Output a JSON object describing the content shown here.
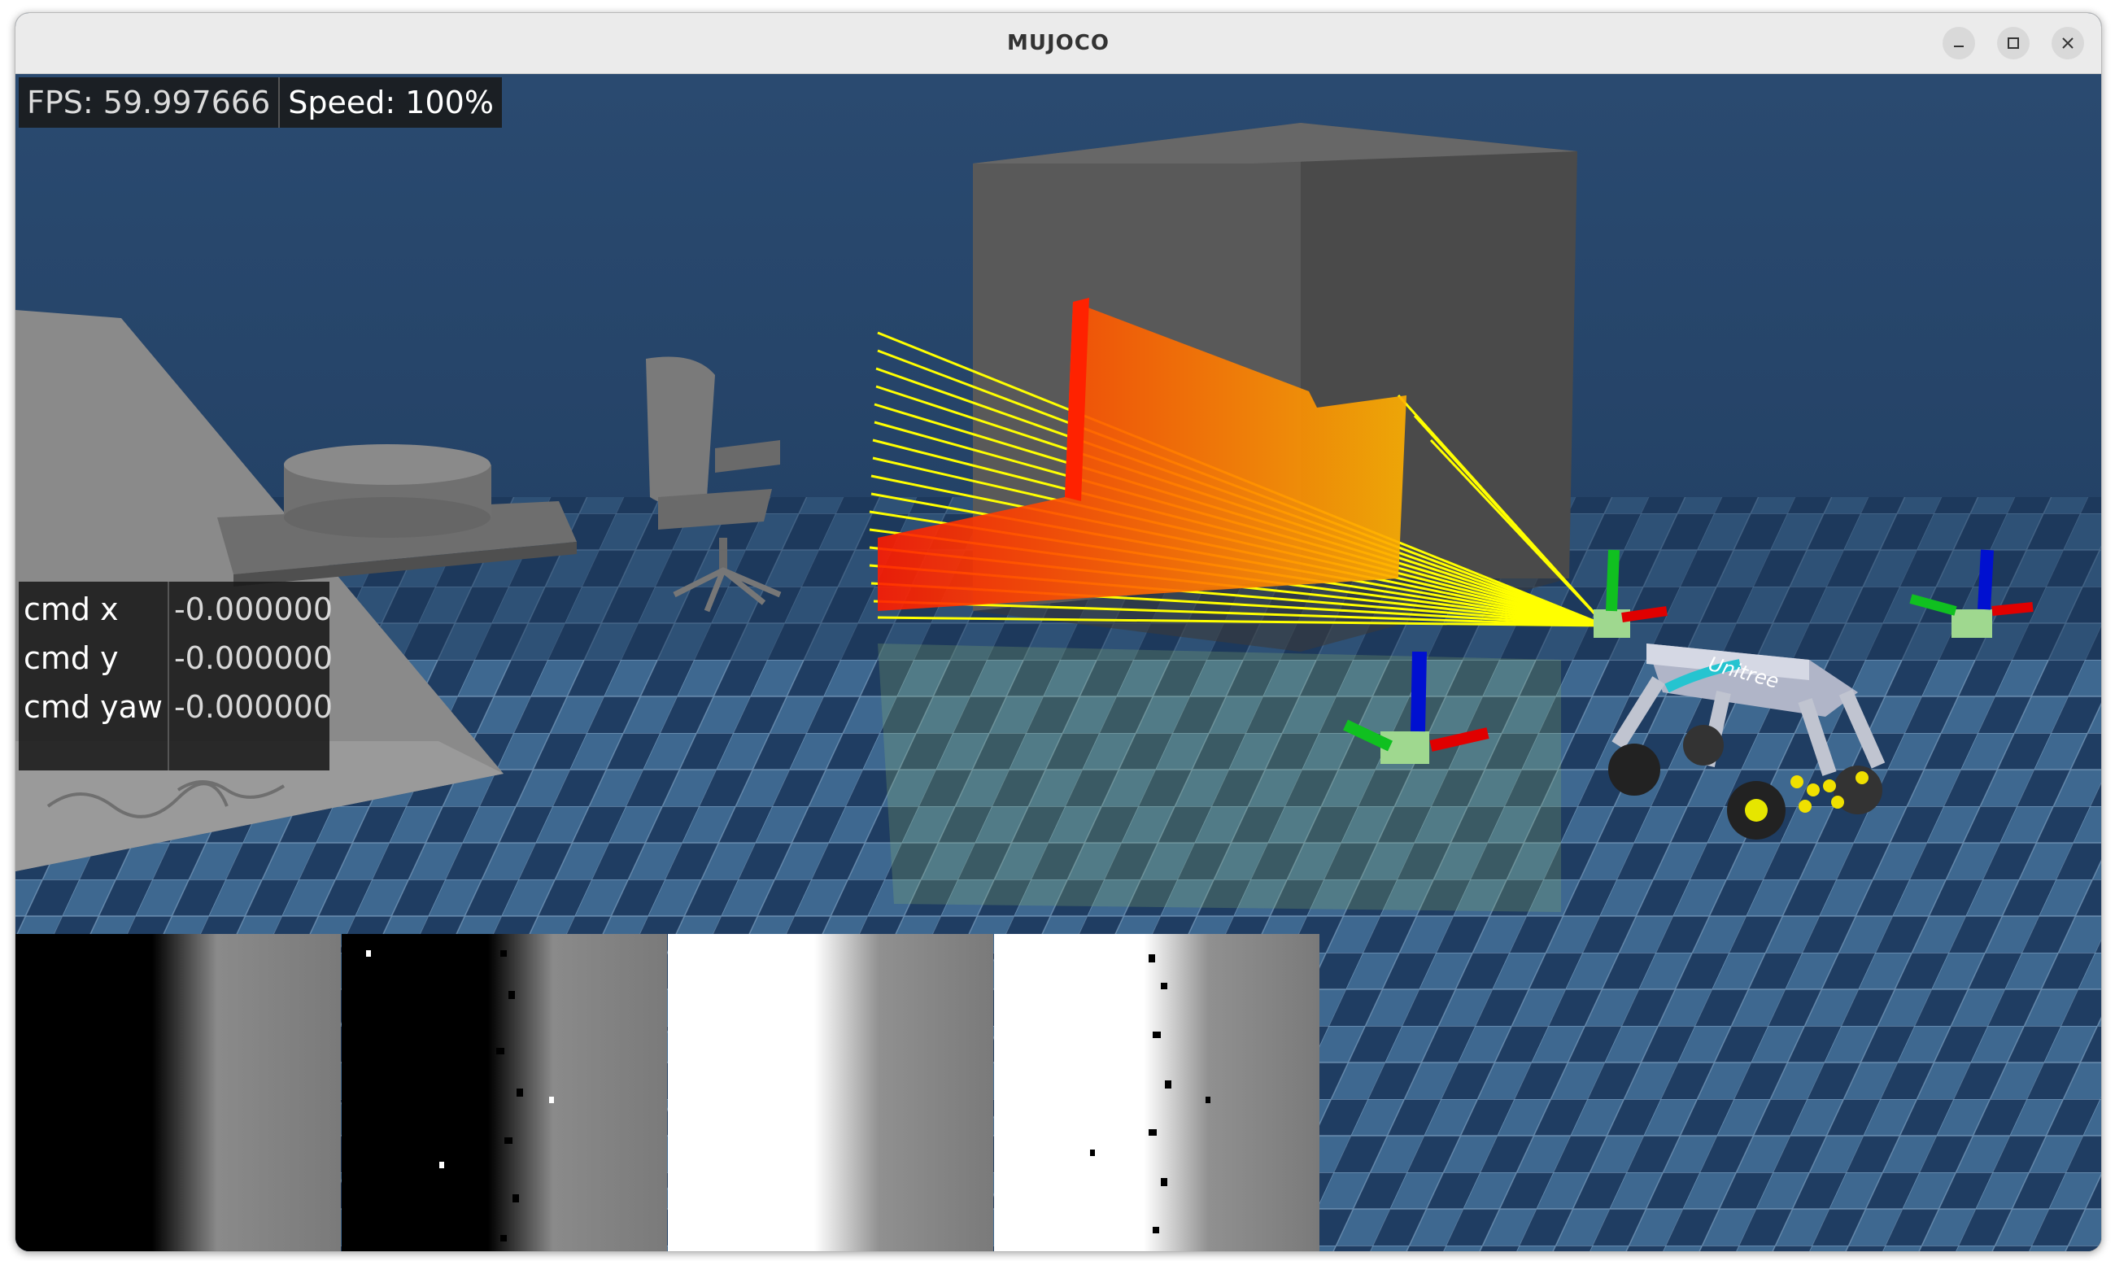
{
  "window": {
    "title": "MUJOCO"
  },
  "window_controls": {
    "minimize": "minimize-icon",
    "maximize": "maximize-icon",
    "close": "close-icon"
  },
  "hud": {
    "fps_label": "FPS: 59.997666",
    "speed_label": "Speed: 100%"
  },
  "commands": {
    "labels": [
      "cmd x",
      "cmd y",
      "cmd yaw"
    ],
    "values": [
      "-0.000000",
      "-0.000000",
      "-0.000000"
    ]
  },
  "robot": {
    "brand_text": "Unitree"
  },
  "colors": {
    "floor_dark": "#1c3a5e",
    "floor_light": "#3f6a93",
    "lidar_ray": "#ffff00",
    "lidar_hit": "#ff2200",
    "axis_x": "#e00000",
    "axis_y": "#10c020",
    "axis_z": "#0010d0"
  },
  "depth_panels": [
    "depth-camera-1",
    "depth-camera-2",
    "depth-camera-3",
    "depth-camera-4"
  ]
}
